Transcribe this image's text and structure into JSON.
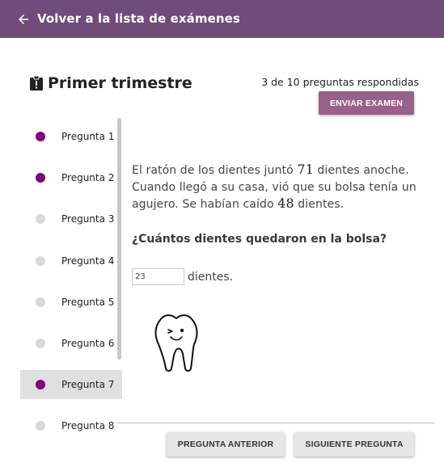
{
  "appbar": {
    "back_label": "Volver a la lista de exámenes",
    "background": "#6f4c79"
  },
  "exam": {
    "title": "Primer trimestre",
    "progress": "3 de 10 preguntas respondidas",
    "submit_label": "ENVIAR EXAMEN"
  },
  "colors": {
    "answered": "#800080",
    "unanswered": "#d9d9d9",
    "submit": "#996189"
  },
  "questions": [
    {
      "label": "Pregunta 1",
      "answered": true
    },
    {
      "label": "Pregunta 2",
      "answered": true
    },
    {
      "label": "Pregunta 3",
      "answered": false
    },
    {
      "label": "Pregunta 4",
      "answered": false
    },
    {
      "label": "Pregunta 5",
      "answered": false
    },
    {
      "label": "Pregunta 6",
      "answered": false
    },
    {
      "label": "Pregunta 7",
      "answered": true,
      "selected": true
    },
    {
      "label": "Pregunta 8",
      "answered": false
    }
  ],
  "problem": {
    "p1": "El ratón de los dientes juntó ",
    "n1": "71",
    "p2": " dientes anoche. Cuando llegó a su casa, vió que su bolsa tenía un agujero. Se habían caído ",
    "n2": "48",
    "p3": " dientes.",
    "question": "¿Cuántos dientes quedaron en la bolsa?",
    "answer_value": "23",
    "answer_unit": "dientes."
  },
  "nav": {
    "prev_label": "PREGUNTA ANTERIOR",
    "next_label": "SIGUIENTE PREGUNTA"
  },
  "icons": {
    "back": "arrow-left-icon",
    "exam": "clipboard-alert-icon",
    "illustration": "smiling-tooth"
  }
}
